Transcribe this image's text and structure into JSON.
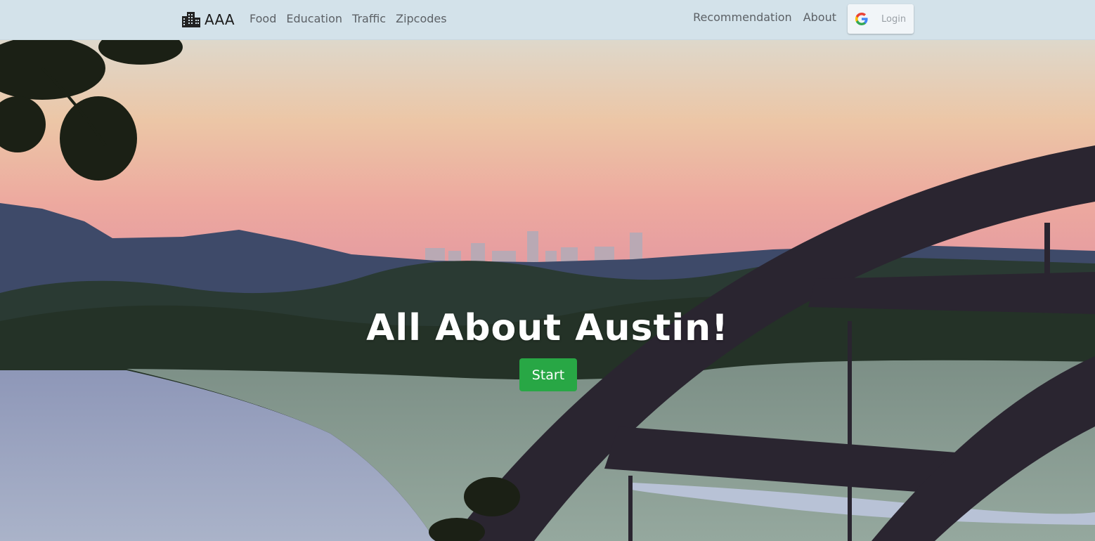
{
  "brand": {
    "icon": "city-icon",
    "name": "AAA"
  },
  "nav": {
    "left": [
      "Food",
      "Education",
      "Traffic",
      "Zipcodes"
    ],
    "right": [
      "Recommendation",
      "About"
    ]
  },
  "login": {
    "icon": "google-icon",
    "label": "Login"
  },
  "hero": {
    "title": "All About Austin!",
    "button_label": "Start",
    "button_color": "#28a745",
    "background": "austin-skyline-bridge-photo"
  },
  "colors": {
    "navbar_bg": "#d3e2ea",
    "nav_text": "#5c6166"
  }
}
